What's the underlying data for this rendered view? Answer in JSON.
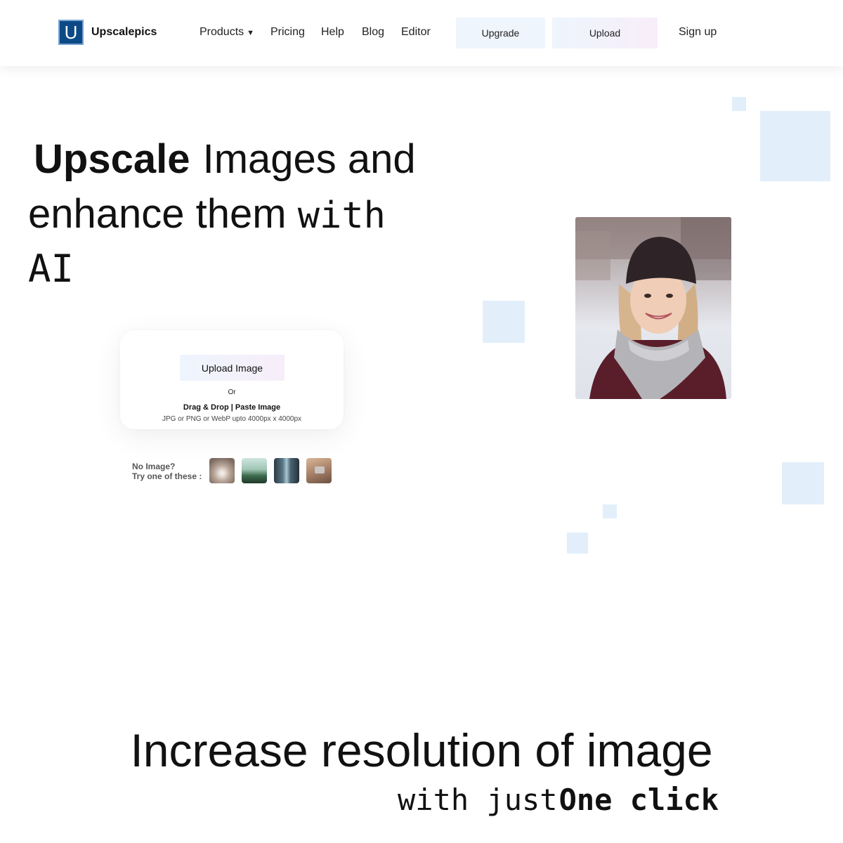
{
  "brand": {
    "logo_letter": "U",
    "name": "Upscalepics"
  },
  "nav": {
    "products": "Products",
    "pricing": "Pricing",
    "help": "Help",
    "blog": "Blog",
    "editor": "Editor",
    "upgrade": "Upgrade",
    "upload": "Upload",
    "signup": "Sign up"
  },
  "hero": {
    "highlight": "Upscale",
    "line1_rest": " Images and",
    "line2": "enhance them ",
    "line2_mono": "with",
    "line3": "AI"
  },
  "upload_card": {
    "button": "Upload Image",
    "or": "Or",
    "drag_drop": "Drag & Drop | Paste Image",
    "formats": "JPG or PNG or WebP upto 4000px x 4000px"
  },
  "samples": {
    "line1": "No Image?",
    "line2": "Try one of these :"
  },
  "section": {
    "title": "Increase resolution of image",
    "sub_prefix": "with just",
    "sub_highlight": "One click"
  },
  "colors": {
    "brand_blue": "#0c4a86",
    "accent_light_blue": "#e2effb",
    "accent_pink": "#f7eefa"
  }
}
